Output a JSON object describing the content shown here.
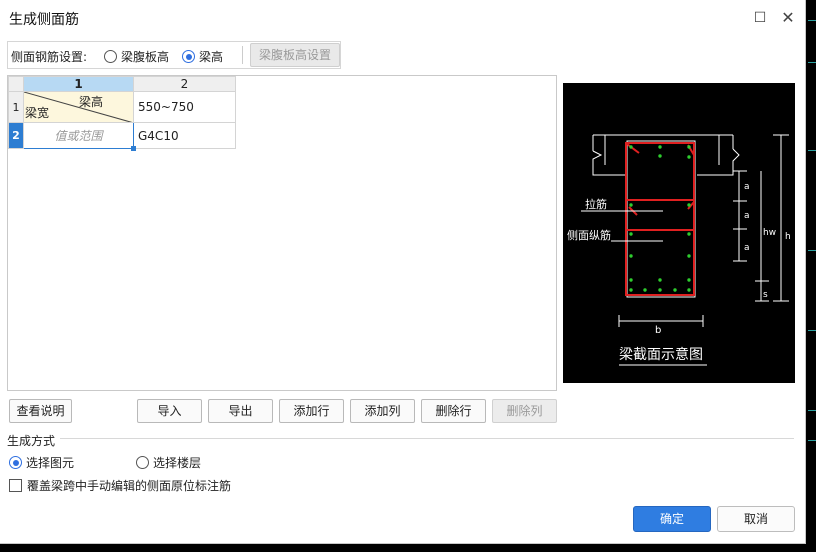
{
  "window": {
    "title": "生成侧面筋",
    "maximize_icon": "maximize-icon",
    "close_icon": "close-icon"
  },
  "setting": {
    "label": "侧面钢筋设置:",
    "options": [
      {
        "label": "梁腹板高",
        "selected": false
      },
      {
        "label": "梁高",
        "selected": true
      }
    ],
    "web_height_button": "梁腹板高设置"
  },
  "grid": {
    "columns": [
      "1",
      "2"
    ],
    "rows": [
      {
        "row_no": "1",
        "header_top": "梁高",
        "header_bottom": "梁宽",
        "value": "550~750"
      },
      {
        "row_no": "2",
        "placeholder": "值或范围",
        "value": "G4C10"
      }
    ]
  },
  "diagram": {
    "caption": "梁截面示意图",
    "label_tie": "拉筋",
    "label_side": "侧面纵筋",
    "dim_a1": "a",
    "dim_a2": "a",
    "dim_a3": "a",
    "dim_hw": "hw",
    "dim_h": "h",
    "dim_s": "s",
    "dim_b": "b"
  },
  "buttons": {
    "view_help": "查看说明",
    "import": "导入",
    "export": "导出",
    "add_row": "添加行",
    "add_col": "添加列",
    "delete_row": "删除行",
    "delete_col": "删除列"
  },
  "generate": {
    "title": "生成方式",
    "options": [
      {
        "label": "选择图元",
        "selected": true
      },
      {
        "label": "选择楼层",
        "selected": false
      }
    ],
    "override_checkbox": "覆盖梁跨中手动编辑的侧面原位标注筋",
    "override_checked": false
  },
  "footer": {
    "ok": "确定",
    "cancel": "取消"
  }
}
